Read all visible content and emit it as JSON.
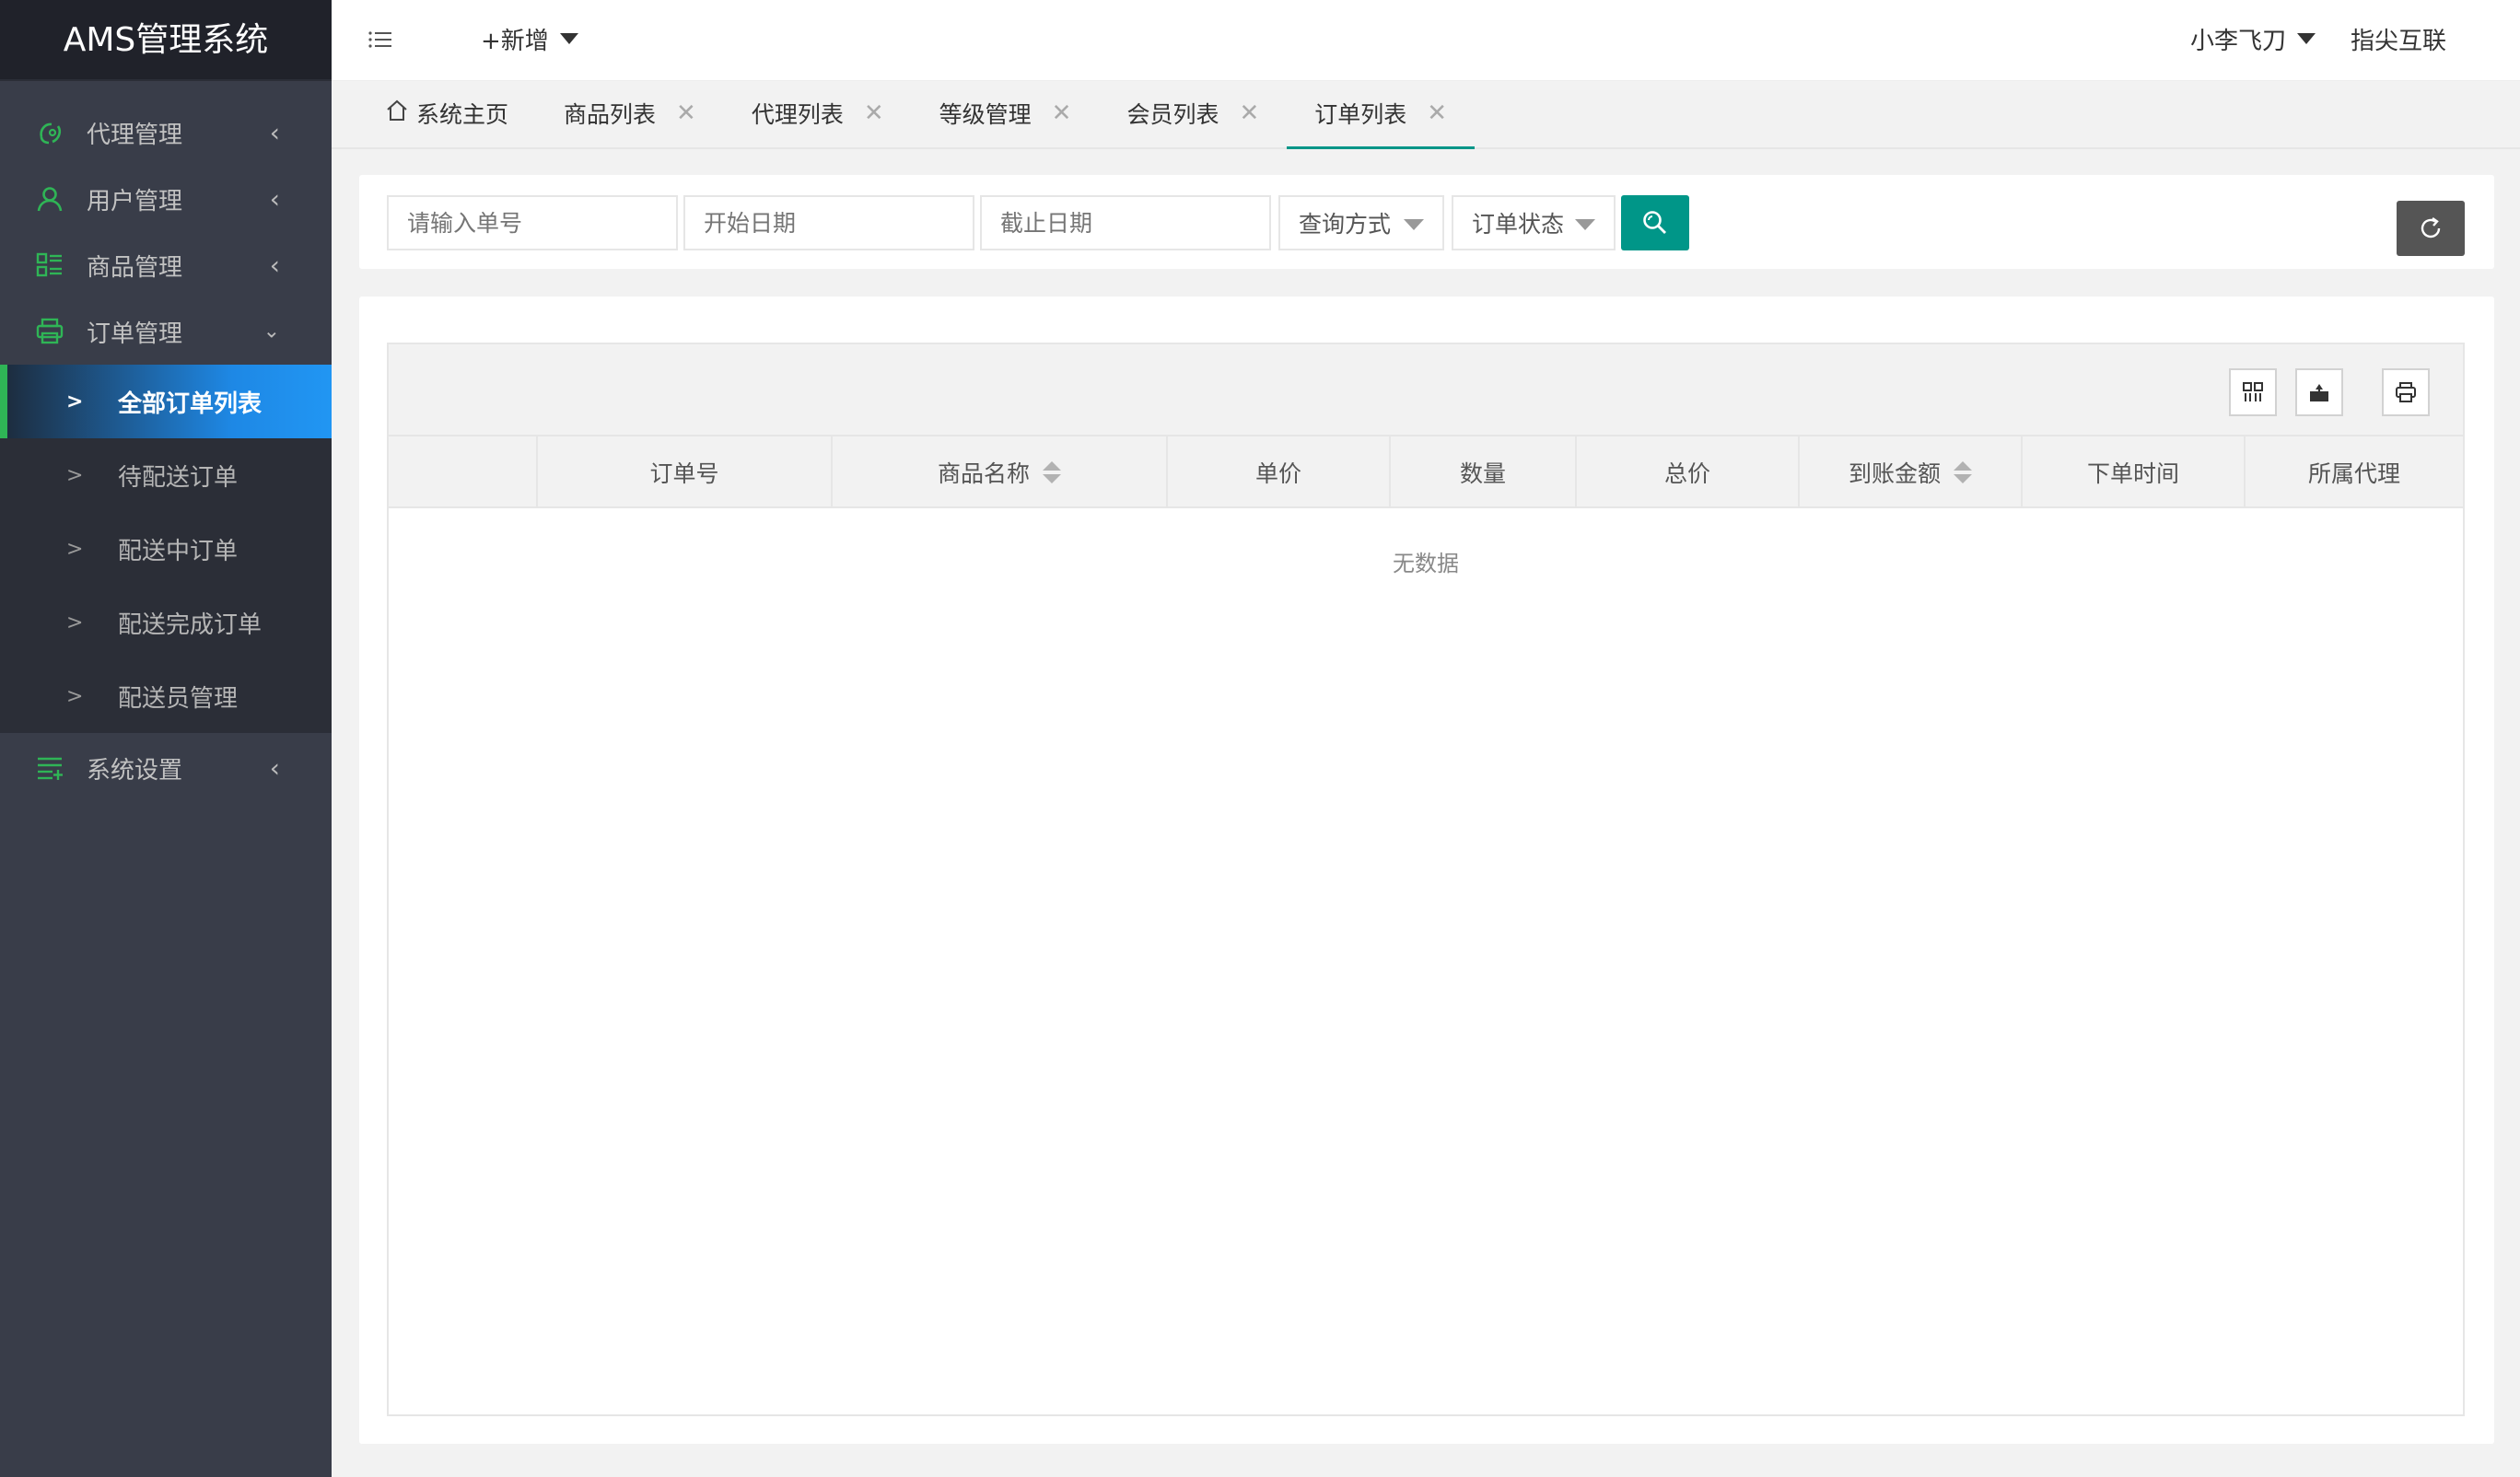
{
  "app": {
    "title": "AMS管理系统"
  },
  "sidebar": {
    "menus": [
      {
        "label": "代理管理",
        "icon": "agent-icon"
      },
      {
        "label": "用户管理",
        "icon": "user-icon"
      },
      {
        "label": "商品管理",
        "icon": "goods-icon"
      },
      {
        "label": "订单管理",
        "icon": "order-icon"
      }
    ],
    "order_sub": [
      {
        "label": "全部订单列表",
        "active": true
      },
      {
        "label": "待配送订单"
      },
      {
        "label": "配送中订单"
      },
      {
        "label": "配送完成订单"
      },
      {
        "label": "配送员管理"
      }
    ],
    "settings": {
      "label": "系统设置",
      "icon": "settings-icon"
    }
  },
  "header": {
    "add_label": "+新增",
    "user_label": "小李飞刀",
    "brand_label": "指尖互联"
  },
  "tabs": [
    {
      "label": "系统主页"
    },
    {
      "label": "商品列表"
    },
    {
      "label": "代理列表"
    },
    {
      "label": "等级管理"
    },
    {
      "label": "会员列表"
    },
    {
      "label": "订单列表",
      "active": true
    }
  ],
  "search": {
    "order_no_placeholder": "请输入单号",
    "start_date_placeholder": "开始日期",
    "end_date_placeholder": "截止日期",
    "query_mode": "查询方式",
    "order_status": "订单状态"
  },
  "table": {
    "columns": [
      "",
      "订单号",
      "商品名称",
      "单价",
      "数量",
      "总价",
      "到账金额",
      "下单时间",
      "所属代理"
    ],
    "empty_text": "无数据"
  },
  "colors": {
    "sidebar_bg": "#393d49",
    "accent": "#009688",
    "active_blue": "#1e88e5"
  }
}
